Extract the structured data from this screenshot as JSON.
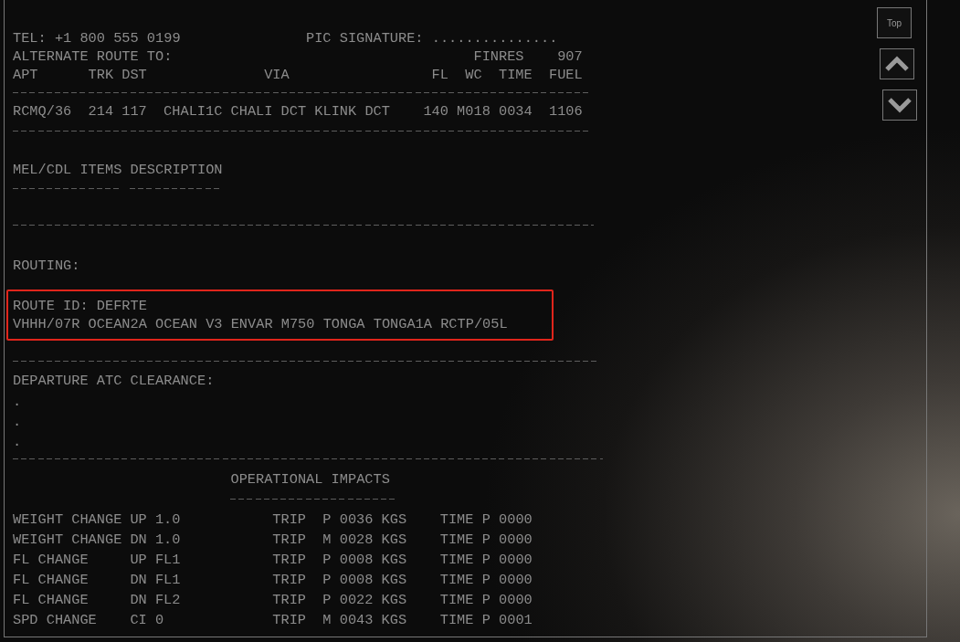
{
  "header": {
    "tel": "TEL: +1 800 555 0199",
    "pic_signature": "PIC SIGNATURE: ..............."
  },
  "alternate": {
    "title": "ALTERNATE ROUTE TO:",
    "finres_label": "FINRES",
    "finres_value": "907",
    "columns": [
      "APT",
      "TRK",
      "DST",
      "VIA",
      "FL",
      "WC",
      "TIME",
      "FUEL"
    ],
    "rows": [
      {
        "apt": "RCMQ/36",
        "trk": "214",
        "dst": "117",
        "via": "CHALI1C CHALI DCT KLINK DCT",
        "fl": "140",
        "wc": "M018",
        "time": "0034",
        "fuel": "1106"
      }
    ]
  },
  "mel": {
    "title": "MEL/CDL ITEMS DESCRIPTION"
  },
  "routing": {
    "label": "ROUTING:",
    "route_id": "ROUTE ID: DEFRTE",
    "route": "VHHH/07R OCEAN2A OCEAN V3 ENVAR M750 TONGA TONGA1A RCTP/05L",
    "highlighted": true
  },
  "departure_clearance": {
    "label": "DEPARTURE ATC CLEARANCE:",
    "lines": [
      ".",
      ".",
      "."
    ]
  },
  "operational_impacts": {
    "title": "OPERATIONAL IMPACTS",
    "rows": [
      {
        "item": "WEIGHT CHANGE",
        "step": "UP 1.0",
        "trip_label": "TRIP",
        "trip_value": "P 0036 KGS",
        "time": "TIME P 0000"
      },
      {
        "item": "WEIGHT CHANGE",
        "step": "DN 1.0",
        "trip_label": "TRIP",
        "trip_value": "M 0028 KGS",
        "time": "TIME P 0000"
      },
      {
        "item": "FL CHANGE",
        "step": "UP FL1",
        "trip_label": "TRIP",
        "trip_value": "P 0008 KGS",
        "time": "TIME P 0000"
      },
      {
        "item": "FL CHANGE",
        "step": "DN FL1",
        "trip_label": "TRIP",
        "trip_value": "P 0008 KGS",
        "time": "TIME P 0000"
      },
      {
        "item": "FL CHANGE",
        "step": "DN FL2",
        "trip_label": "TRIP",
        "trip_value": "P 0022 KGS",
        "time": "TIME P 0000"
      },
      {
        "item": "SPD CHANGE",
        "step": "CI 0",
        "trip_label": "TRIP",
        "trip_value": "M 0043 KGS",
        "time": "TIME P 0001"
      }
    ]
  },
  "nav": {
    "top_label": "Top"
  }
}
